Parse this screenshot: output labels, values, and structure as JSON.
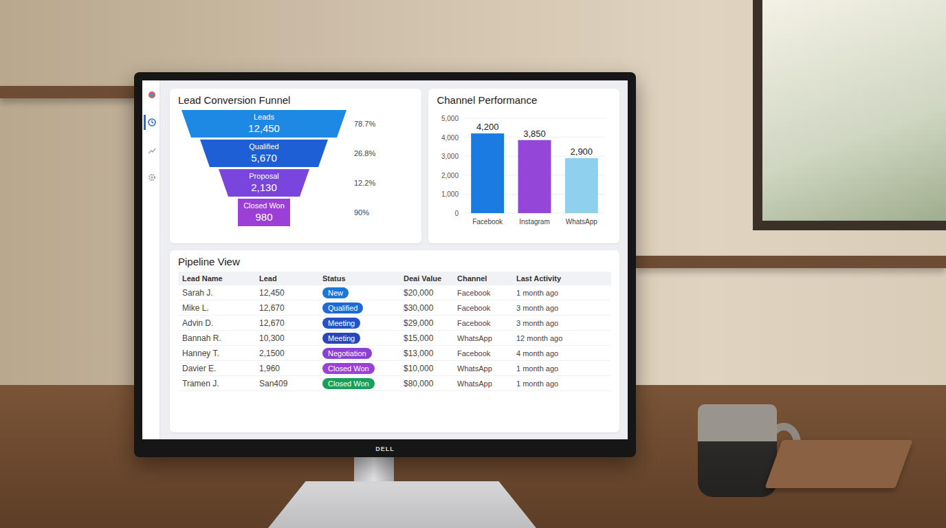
{
  "monitor": {
    "brand": "DELL"
  },
  "sidebar": {
    "items": [
      {
        "selected": false
      },
      {
        "selected": true
      },
      {
        "selected": false
      },
      {
        "selected": false
      }
    ]
  },
  "funnel": {
    "title": "Lead Conversion Funnel",
    "stages": [
      {
        "label": "Leads",
        "value": "12,450",
        "rate": "78.7%",
        "color": "#1e88e5"
      },
      {
        "label": "Qualified",
        "value": "5,670",
        "rate": "26.8%",
        "color": "#1f5fd6"
      },
      {
        "label": "Proposal",
        "value": "2,130",
        "rate": "12.2%",
        "color": "#7a45dd"
      },
      {
        "label": "Closed Won",
        "value": "980",
        "rate": "90%",
        "color": "#9b3fd6"
      }
    ]
  },
  "channel_chart": {
    "title": "Channel Performance",
    "ticks": [
      "0",
      "1,000",
      "2,000",
      "3,000",
      "4,000",
      "5,000"
    ],
    "bars": [
      {
        "label": "Facebook",
        "value": 4200,
        "reading": "4,200",
        "color": "#1c7be0"
      },
      {
        "label": "Instagram",
        "value": 3850,
        "reading": "3,850",
        "color": "#9446d8"
      },
      {
        "label": "WhatsApp",
        "value": 2900,
        "reading": "2,900",
        "color": "#8fd0ee"
      }
    ]
  },
  "table": {
    "title": "Pipeline View",
    "columns": [
      "Lead Name",
      "Lead",
      "Status",
      "Deai Value",
      "Channel",
      "Last Activity"
    ],
    "rows": [
      {
        "name": "Sarah J.",
        "lead": "12,450",
        "status": "New",
        "color": "#1a78d8",
        "value": "$20,000",
        "channel": "Facebook",
        "activity": "1 month ago"
      },
      {
        "name": "Mike L.",
        "lead": "12,670",
        "status": "Qualified",
        "color": "#1d6ad6",
        "value": "$30,000",
        "channel": "Facebook",
        "activity": "3 month ago"
      },
      {
        "name": "Advin D.",
        "lead": "12,670",
        "status": "Meeting",
        "color": "#2353c6",
        "value": "$29,000",
        "channel": "Facebook",
        "activity": "3 month ago"
      },
      {
        "name": "Bannah R.",
        "lead": "10,300",
        "status": "Meeting",
        "color": "#2a45b8",
        "value": "$15,000",
        "channel": "WhatsApp",
        "activity": "12 month ago"
      },
      {
        "name": "Hanney T.",
        "lead": "2,1500",
        "status": "Negotiation",
        "color": "#8c3fd4",
        "value": "$13,000",
        "channel": "Facebook",
        "activity": "4 month ago"
      },
      {
        "name": "Davier E.",
        "lead": "1,960",
        "status": "Closed Won",
        "color": "#9a3fd8",
        "value": "$10,000",
        "channel": "WhatsApp",
        "activity": "1 month ago"
      },
      {
        "name": "Tramen J.",
        "lead": "San409",
        "status": "Closed Won",
        "color": "#18a05a",
        "value": "$80,000",
        "channel": "WhatsApp",
        "activity": "1 month ago"
      }
    ]
  }
}
